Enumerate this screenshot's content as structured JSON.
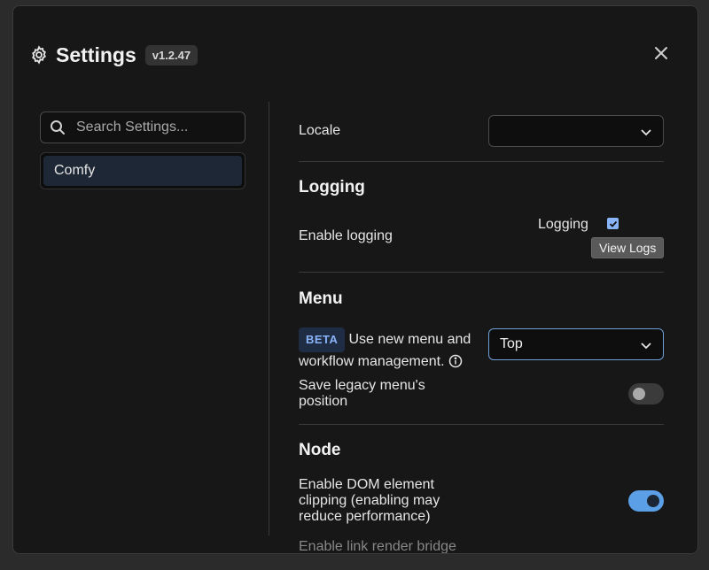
{
  "dialog": {
    "title": "Settings",
    "version": "v1.2.47",
    "icons": {
      "gear": "gear-icon",
      "close": "close-icon"
    }
  },
  "sidebar": {
    "search_placeholder": "Search Settings...",
    "categories": [
      {
        "label": "Comfy",
        "selected": true
      }
    ]
  },
  "settings": {
    "locale": {
      "label": "Locale",
      "value": ""
    },
    "logging": {
      "section_title": "Logging",
      "enable_label": "Enable logging",
      "checkbox_label": "Logging",
      "checkbox_checked": true,
      "view_logs_label": "View Logs"
    },
    "menu": {
      "section_title": "Menu",
      "beta_badge": "BETA",
      "new_menu_label_line1": "Use new menu and",
      "new_menu_label_line2": "workflow management.",
      "new_menu_value": "Top",
      "legacy_label_line1": "Save legacy menu's",
      "legacy_label_line2": "position",
      "legacy_enabled": false
    },
    "node": {
      "section_title": "Node",
      "clipping_label_line1": "Enable DOM element",
      "clipping_label_line2": "clipping (enabling may",
      "clipping_label_line3": "reduce performance)",
      "clipping_enabled": true,
      "next_label_partial": "Enable link render bridge"
    }
  },
  "colors": {
    "accent": "#8ab4f8",
    "toggle_on": "#5b9fe6",
    "background": "#171717"
  }
}
